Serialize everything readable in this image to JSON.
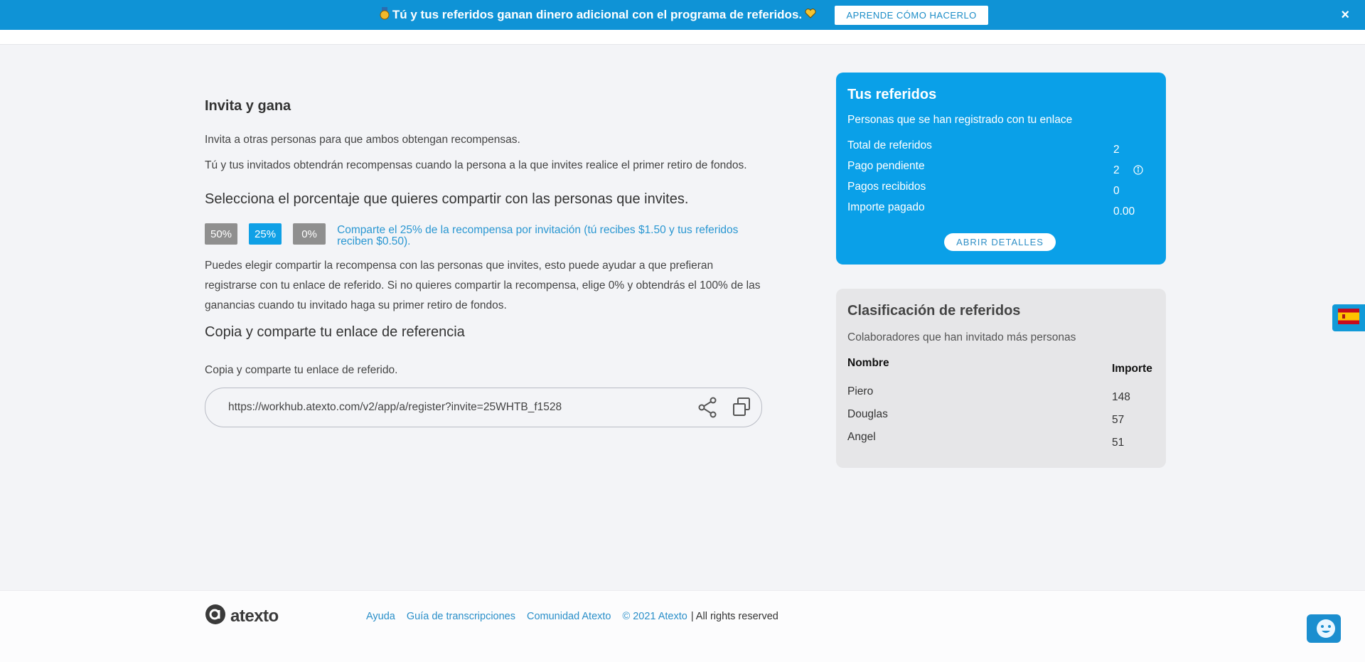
{
  "banner": {
    "text": "Tú y tus referidos ganan dinero adicional con el programa de referidos.",
    "button_label": "APRENDE CÓMO HACERLO",
    "close_glyph": "×"
  },
  "invite": {
    "title": "Invita y gana",
    "p1": "Invita a otras personas para que ambos obtengan recompensas.",
    "p2": "Tú y tus invitados obtendrán recompensas cuando la persona a la que invites realice el primer retiro de fondos.",
    "share_heading": "Selecciona el porcentaje que quieres compartir con las personas que invites.",
    "percent_options": [
      "50%",
      "25%",
      "0%"
    ],
    "selected_percent": "25%",
    "percent_note": "Comparte el 25% de la recompensa por invitación (tú recibes $1.50 y tus referidos reciben $0.50).",
    "p3": "Puedes elegir compartir la recompensa con las personas que invites, esto puede ayudar a que prefieran registrarse con tu enlace de referido. Si no quieres compartir la recompensa, elige 0% y obtendrás el 100% de las ganancias cuando tu invitado haga su primer retiro de fondos.",
    "link_heading": "Copia y comparte tu enlace de referencia",
    "link_label": "Copia y comparte tu enlace de referido.",
    "link_value": "https://workhub.atexto.com/v2/app/a/register?invite=25WHTB_f1528"
  },
  "referrals": {
    "title": "Tus referidos",
    "subtitle": "Personas que se han registrado con tu enlace",
    "stats": [
      {
        "label": "Total de referidos",
        "value": "2"
      },
      {
        "label": "Pago pendiente",
        "value": "2"
      },
      {
        "label": "Pagos recibidos",
        "value": "0"
      },
      {
        "label": "Importe pagado",
        "value": "0.00"
      }
    ],
    "details_button": "ABRIR DETALLES"
  },
  "ranking": {
    "title": "Clasificación de referidos",
    "subtitle": "Colaboradores que han invitado más personas",
    "col_name": "Nombre",
    "col_amount": "Importe",
    "rows": [
      {
        "name": "Piero",
        "amount": "148"
      },
      {
        "name": "Douglas",
        "amount": "57"
      },
      {
        "name": "Angel",
        "amount": "51"
      }
    ]
  },
  "footer": {
    "logo_text": "atexto",
    "links": [
      "Ayuda",
      "Guía de transcripciones",
      "Comunidad Atexto",
      "© 2021 Atexto"
    ],
    "rights": "| All rights reserved"
  },
  "colors": {
    "banner": "#0f93d6",
    "accent_blue": "#0aa0e8",
    "link_blue": "#2a97d2",
    "gray_button": "#8f8f8f"
  },
  "icons": [
    "medal-icon",
    "heart-icon",
    "close-icon",
    "share-icon",
    "copy-icon",
    "info-icon",
    "spain-flag-icon",
    "chat-bot-icon",
    "atexto-logo-icon"
  ]
}
